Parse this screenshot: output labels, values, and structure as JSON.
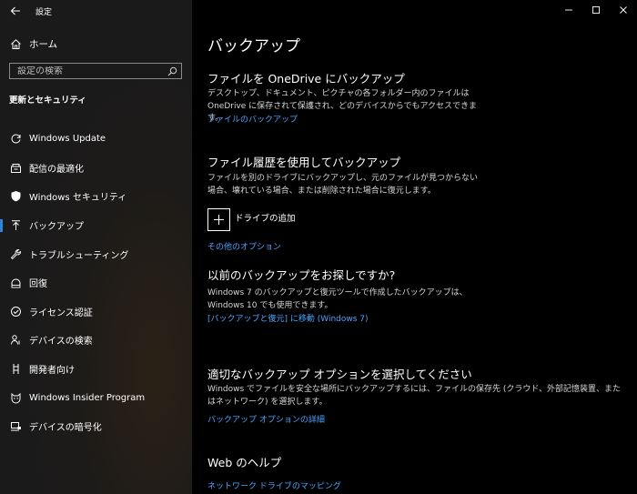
{
  "window": {
    "title": "設定"
  },
  "sidebar": {
    "home_label": "ホーム",
    "search_placeholder": "設定の検索",
    "section_title": "更新とセキュリティ",
    "items": [
      {
        "label": "Windows Update",
        "icon": "refresh-icon"
      },
      {
        "label": "配信の最適化",
        "icon": "delivery-optimization-icon"
      },
      {
        "label": "Windows セキュリティ",
        "icon": "shield-icon"
      },
      {
        "label": "バックアップ",
        "icon": "backup-arrow-icon",
        "selected": true
      },
      {
        "label": "トラブルシューティング",
        "icon": "wrench-icon"
      },
      {
        "label": "回復",
        "icon": "recovery-icon"
      },
      {
        "label": "ライセンス認証",
        "icon": "check-circle-icon"
      },
      {
        "label": "デバイスの検索",
        "icon": "person-pin-icon"
      },
      {
        "label": "開発者向け",
        "icon": "developer-icon"
      },
      {
        "label": "Windows Insider Program",
        "icon": "insider-cat-icon"
      },
      {
        "label": "デバイスの暗号化",
        "icon": "device-encryption-icon"
      }
    ]
  },
  "main": {
    "page_title": "バックアップ",
    "onedrive": {
      "heading": "ファイルを OneDrive にバックアップ",
      "desc": "デスクトップ、ドキュメント、ピクチャの各フォルダー内のファイルは OneDrive に保存されて保護され、どのデバイスからでもアクセスできます。",
      "link": "ファイルのバックアップ"
    },
    "file_history": {
      "heading": "ファイル履歴を使用してバックアップ",
      "desc": "ファイルを別のドライブにバックアップし、元のファイルが見つからない場合、壊れている場合、または削除された場合に復元します。",
      "add_drive": "ドライブの追加",
      "more_options": "その他のオプション"
    },
    "older": {
      "heading": "以前のバックアップをお探しですか?",
      "desc": "Windows 7 のバックアップと復元ツールで作成したバックアップは、Windows 10 でも使用できます。",
      "link": "[バックアップと復元] に移動 (Windows 7)"
    },
    "choose": {
      "heading": "適切なバックアップ オプションを選択してください",
      "desc": "Windows でファイルを安全な場所にバックアップするには、ファイルの保存先 (クラウド、外部記憶装置、またはネットワーク) を選択します。",
      "link": "バックアップ オプションの詳細"
    },
    "web_help": {
      "heading": "Web のヘルプ",
      "link": "ネットワーク ドライブのマッピング"
    }
  },
  "colors": {
    "accent": "#2b88d8",
    "link": "#4da3ff",
    "background": "#000000"
  }
}
